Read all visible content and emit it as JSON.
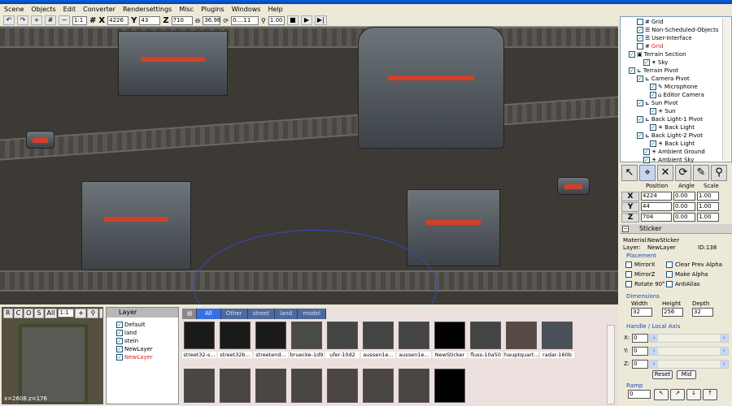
{
  "menu": [
    "Scene",
    "Objects",
    "Edit",
    "Converter",
    "Rendersettings",
    "Misc",
    "Plugins",
    "Windows",
    "Help"
  ],
  "toolbar": {
    "zoom_ratio": "1:1",
    "x": "4226",
    "y": "43",
    "z": "710",
    "angle": "36.96",
    "range": "0....11",
    "scale": "1.00",
    "x_label": "X",
    "y_label": "Y",
    "z_label": "Z"
  },
  "tree": [
    {
      "label": "Grid",
      "checked": false
    },
    {
      "label": "Non-Scheduled-Objects",
      "checked": true
    },
    {
      "label": "User-Interface",
      "checked": true
    },
    {
      "label": "Grid",
      "checked": false,
      "highlight": true
    },
    {
      "label": "Terrain Section",
      "checked": true
    },
    {
      "label": "Sky",
      "checked": true
    },
    {
      "label": "Terrain Pivot",
      "checked": true
    },
    {
      "label": "Camera Pivot",
      "checked": true
    },
    {
      "label": "Microphone",
      "checked": true
    },
    {
      "label": "Editor Camera",
      "checked": true
    },
    {
      "label": "Sun Pivot",
      "checked": true
    },
    {
      "label": "Sun",
      "checked": true
    },
    {
      "label": "Back Light-1 Pivot",
      "checked": true
    },
    {
      "label": "Back Light",
      "checked": true
    },
    {
      "label": "Back Light-2 Pivot",
      "checked": true
    },
    {
      "label": "Back Light",
      "checked": true
    },
    {
      "label": "Ambient Ground",
      "checked": true
    },
    {
      "label": "Ambient Sky",
      "checked": true
    }
  ],
  "transform": {
    "headers": [
      "Position",
      "Angle",
      "Scale"
    ],
    "rows": [
      {
        "axis": "X",
        "position": "4224",
        "angle": "0.00",
        "scale": "1.00"
      },
      {
        "axis": "Y",
        "position": "44",
        "angle": "0.00",
        "scale": "1.00"
      },
      {
        "axis": "Z",
        "position": "704",
        "angle": "0.00",
        "scale": "1.00"
      }
    ]
  },
  "sticker": {
    "title": "Sticker",
    "material_label": "Material:",
    "material": "NewSticker",
    "layer_label": "Layer:",
    "layer": "NewLayer",
    "id": "ID:138",
    "placement": "Placement",
    "options": [
      "MirrorX",
      "Clear Prev Alpha",
      "MirrorZ",
      "Make Alpha",
      "Rotate 90°",
      "AntiAlias"
    ],
    "dimensions": "Dimensions",
    "width_label": "Width",
    "height_label": "Height",
    "depth_label": "Depth",
    "width": "32",
    "height": "256",
    "depth": "32",
    "handle": "Handle / Local Axis",
    "hx": "0",
    "hy": "0",
    "hz": "0",
    "reset": "Reset",
    "mid": "Mid",
    "ramp": "Ramp",
    "ramp_value": "0"
  },
  "minimap": {
    "buttons": [
      "R",
      "C",
      "O",
      "S",
      "All"
    ],
    "ratio": "1:1",
    "coords": "x=2608 z=176"
  },
  "layers": {
    "title": "Layer",
    "items": [
      {
        "label": "Default"
      },
      {
        "label": "land"
      },
      {
        "label": "stein"
      },
      {
        "label": "NewLayer"
      },
      {
        "label": "NewLayer",
        "active": true
      }
    ]
  },
  "assets": {
    "tabs": [
      "All",
      "Other",
      "street",
      "land",
      "model"
    ],
    "items": [
      "street32-s...",
      "street32b...",
      "streetend...",
      "bruecke-1d9",
      "ufer-10d2",
      "aussen1e...",
      "aussen1e...",
      "NewSticker",
      "fluss-10a50",
      "hauptquart...",
      "radar-160b"
    ]
  }
}
